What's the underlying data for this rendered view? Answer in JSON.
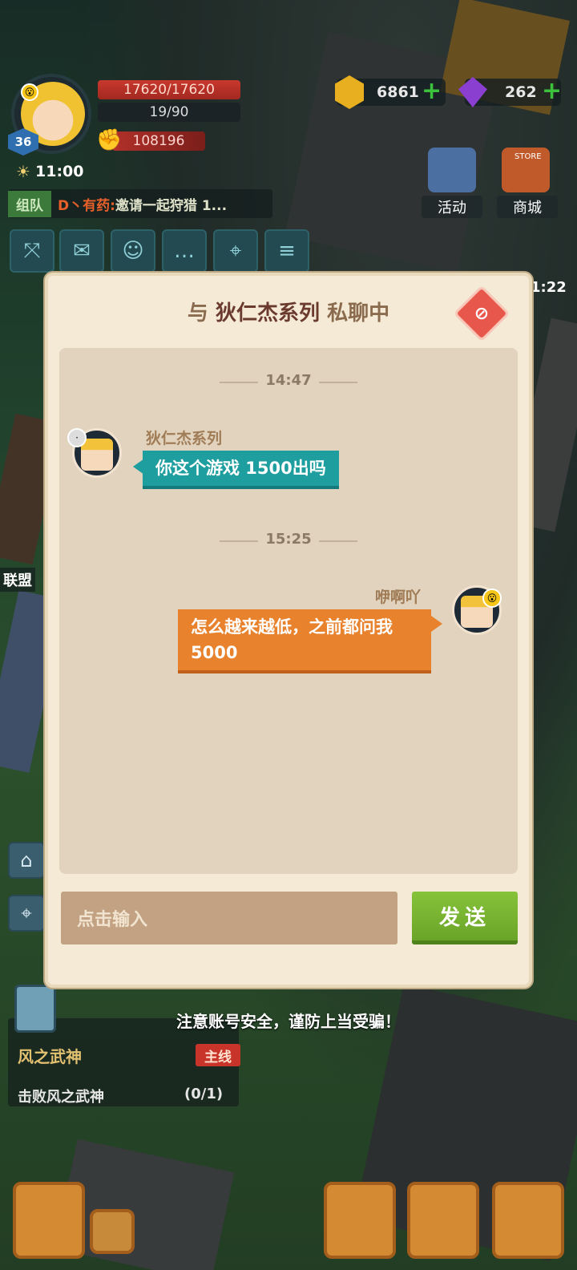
{
  "hud": {
    "level": "36",
    "hp": "17620/17620",
    "energy": "19/90",
    "power": "108196",
    "time": "11:00",
    "gold": "6861",
    "gems": "262",
    "events_label": "活动",
    "store_label": "商城",
    "store_sign": "STORE",
    "right_timer": "1:22",
    "alliance_label": "联盟"
  },
  "world_chat": {
    "tag": "组队",
    "name": "D丶有药:",
    "text": "邀请一起狩猎 1..."
  },
  "dialog": {
    "title_prefix": "与",
    "partner_name": "狄仁杰系列",
    "title_suffix": "私聊中",
    "messages": [
      {
        "timestamp": "14:47",
        "sender": "狄仁杰系列",
        "text": "你这个游戏 1500出吗",
        "side": "left"
      },
      {
        "timestamp": "15:25",
        "sender": "咿啊吖",
        "text": "怎么越来越低，之前都问我5000",
        "side": "right"
      }
    ],
    "input_placeholder": "点击输入",
    "send_label": "发送"
  },
  "warning": "注意账号安全，谨防上当受骗！",
  "quest": {
    "title": "风之武神",
    "tag": "主线",
    "description": "击败风之武神",
    "progress": "(0/1)"
  },
  "colors": {
    "bubble_left": "#1f9ea0",
    "bubble_right": "#e8822d",
    "send_button": "#7ab632",
    "dialog_bg": "#f4ead6"
  }
}
